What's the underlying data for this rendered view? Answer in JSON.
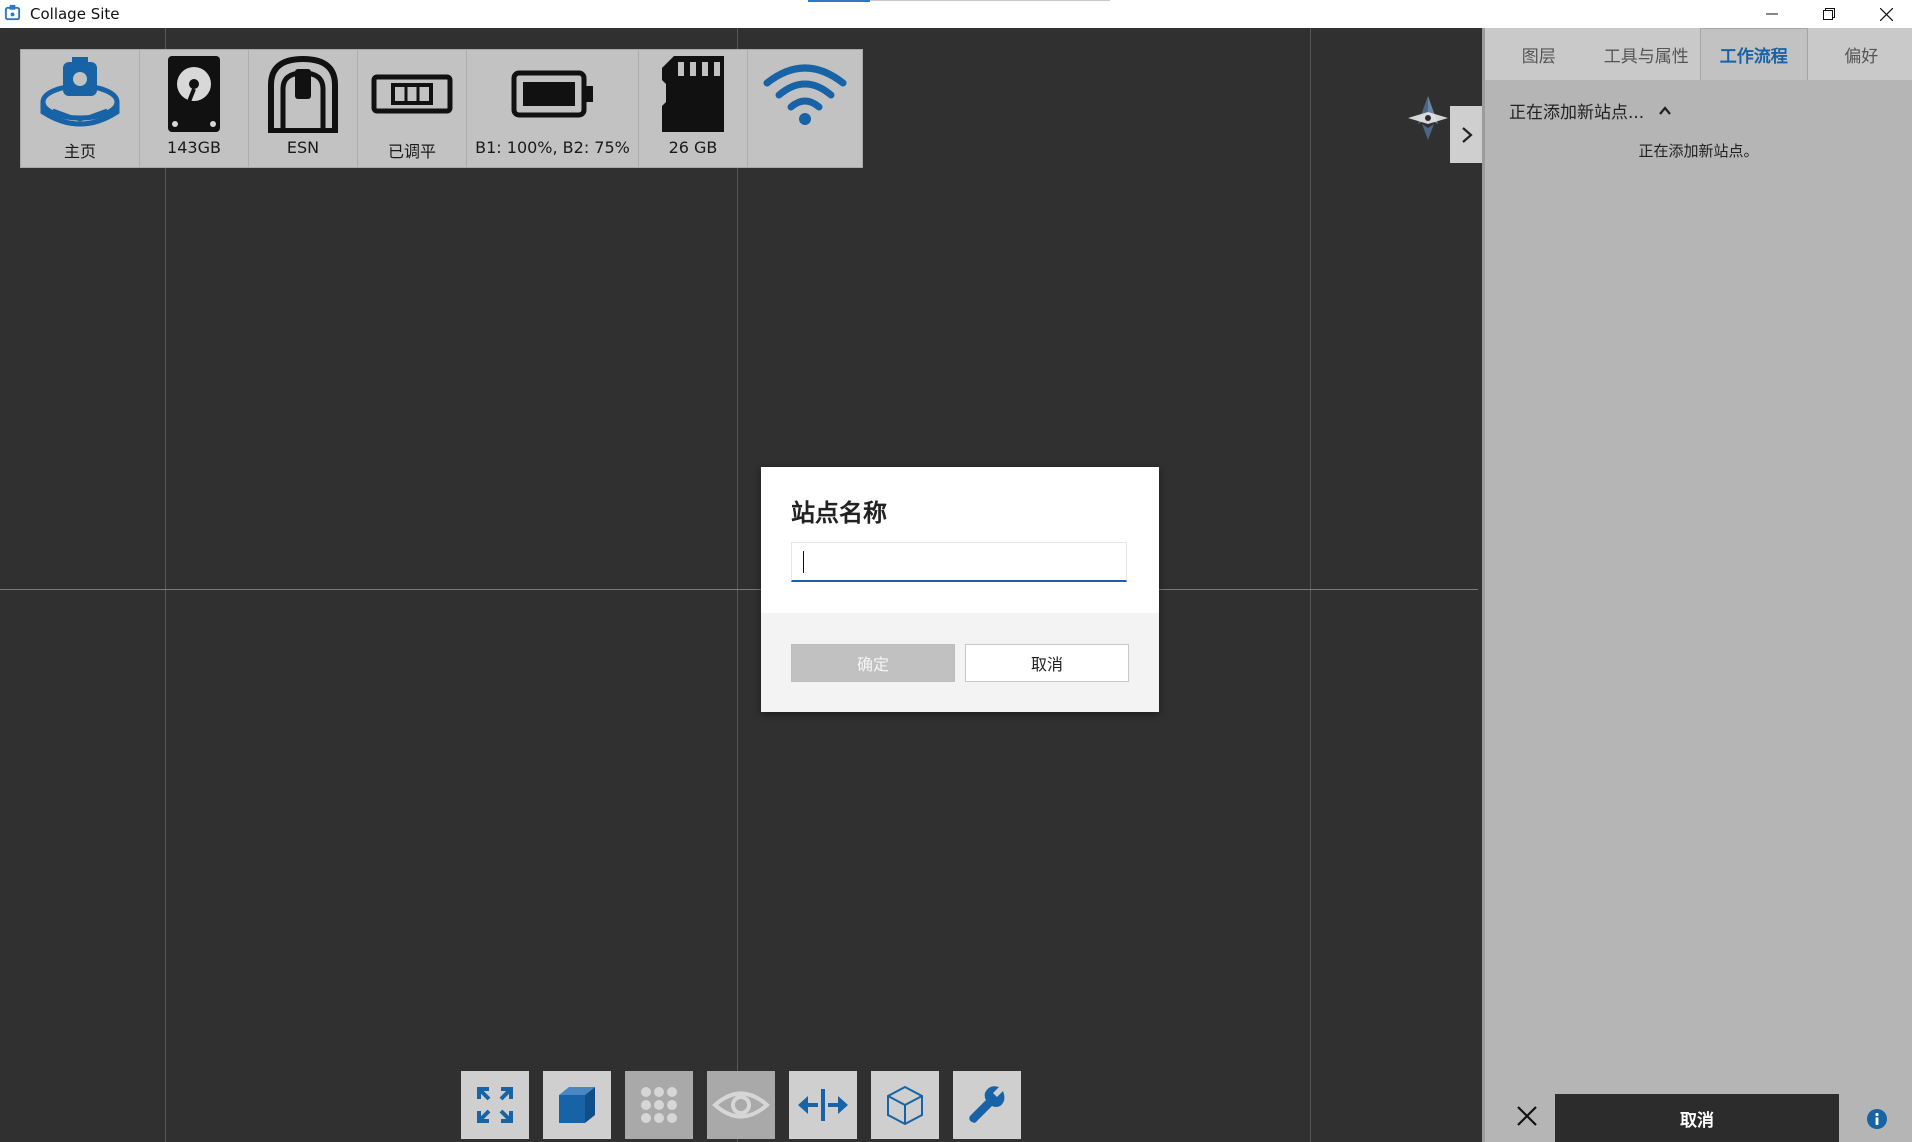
{
  "window": {
    "title": "Collage Site"
  },
  "status_bar": {
    "items": [
      {
        "icon": "home-station-icon",
        "label": "主页"
      },
      {
        "icon": "hard-drive-icon",
        "label": "143GB"
      },
      {
        "icon": "scanner-esn-icon",
        "label": "ESN"
      },
      {
        "icon": "level-icon",
        "label": "已调平"
      },
      {
        "icon": "battery-icon",
        "label": "B1: 100%, B2: 75%"
      },
      {
        "icon": "sd-card-icon",
        "label": "26 GB"
      },
      {
        "icon": "wifi-icon",
        "label": ""
      }
    ]
  },
  "right_panel": {
    "tabs": [
      {
        "label": "图层",
        "active": false
      },
      {
        "label": "工具与属性",
        "active": false
      },
      {
        "label": "工作流程",
        "active": true
      },
      {
        "label": "偏好",
        "active": false
      }
    ],
    "section_title": "正在添加新站点...",
    "section_text": "正在添加新站点。",
    "cancel_label": "取消"
  },
  "dialog": {
    "title": "站点名称",
    "input_value": "",
    "ok_label": "确定",
    "cancel_label": "取消"
  },
  "toolbar": {
    "tools": [
      {
        "icon": "fit-extents-icon",
        "dim": false
      },
      {
        "icon": "3d-cube-icon",
        "dim": false
      },
      {
        "icon": "grid-dots-icon",
        "dim": true
      },
      {
        "icon": "eye-icon",
        "dim": true
      },
      {
        "icon": "measure-distance-icon",
        "dim": false
      },
      {
        "icon": "wireframe-cube-icon",
        "dim": false
      },
      {
        "icon": "wrench-icon",
        "dim": false
      }
    ]
  },
  "colors": {
    "accent": "#1763a6",
    "viewport": "#303030",
    "panel": "#b5b5b5"
  }
}
